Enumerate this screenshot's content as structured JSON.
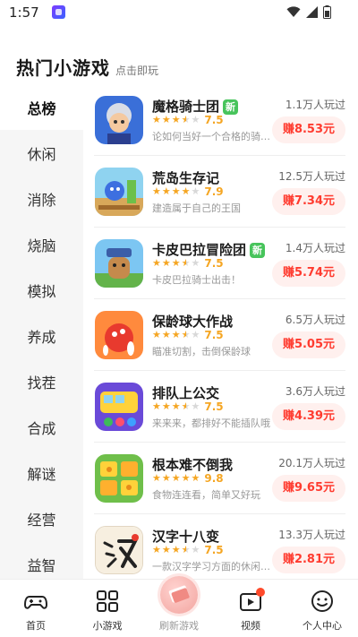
{
  "status_bar": {
    "time": "1:57"
  },
  "heading": {
    "title": "热门小游戏",
    "subtitle": "点击即玩"
  },
  "categories": [
    {
      "label": "总榜",
      "active": true
    },
    {
      "label": "休闲",
      "active": false
    },
    {
      "label": "消除",
      "active": false
    },
    {
      "label": "烧脑",
      "active": false
    },
    {
      "label": "模拟",
      "active": false
    },
    {
      "label": "养成",
      "active": false
    },
    {
      "label": "找茬",
      "active": false
    },
    {
      "label": "合成",
      "active": false
    },
    {
      "label": "解谜",
      "active": false
    },
    {
      "label": "经营",
      "active": false
    },
    {
      "label": "益智",
      "active": false
    }
  ],
  "games": [
    {
      "name": "魔格骑士团",
      "new_tag": "新",
      "score": "7.5",
      "stars": 3.5,
      "desc": "论如何当好一个合格的骑士团长",
      "players": "1.1万人玩过",
      "earn": "赚8.53元"
    },
    {
      "name": "荒岛生存记",
      "new_tag": "",
      "score": "7.9",
      "stars": 4,
      "desc": "建造属于自己的王国",
      "players": "12.5万人玩过",
      "earn": "赚7.34元"
    },
    {
      "name": "卡皮巴拉冒险团",
      "new_tag": "新",
      "score": "7.5",
      "stars": 3.5,
      "desc": "卡皮巴拉骑士出击！",
      "players": "1.4万人玩过",
      "earn": "赚5.74元"
    },
    {
      "name": "保龄球大作战",
      "new_tag": "",
      "score": "7.5",
      "stars": 3.5,
      "desc": "瞄准切割，击倒保龄球",
      "players": "6.5万人玩过",
      "earn": "赚5.05元"
    },
    {
      "name": "排队上公交",
      "new_tag": "",
      "score": "7.5",
      "stars": 3.5,
      "desc": "来来来，都排好不能插队哦",
      "players": "3.6万人玩过",
      "earn": "赚4.39元"
    },
    {
      "name": "根本难不倒我",
      "new_tag": "",
      "score": "9.8",
      "stars": 5,
      "desc": "食物连连看，简单又好玩",
      "players": "20.1万人玩过",
      "earn": "赚9.65元"
    },
    {
      "name": "汉字十八变",
      "new_tag": "",
      "score": "7.5",
      "stars": 3.5,
      "desc": "一款汉字学习方面的休闲益智游戏",
      "players": "13.3万人玩过",
      "earn": "赚2.81元"
    }
  ],
  "tabs": [
    {
      "label": "首页",
      "icon": "gamepad-icon"
    },
    {
      "label": "小游戏",
      "icon": "grid-icon"
    },
    {
      "label": "刷新游戏",
      "icon": "money-icon"
    },
    {
      "label": "视频",
      "icon": "video-icon"
    },
    {
      "label": "个人中心",
      "icon": "smile-icon"
    }
  ],
  "colors": {
    "accent": "#ff3b2f",
    "star": "#f5a623",
    "new_tag": "#47c45b",
    "sidebar_bg": "#f6f6f6"
  }
}
